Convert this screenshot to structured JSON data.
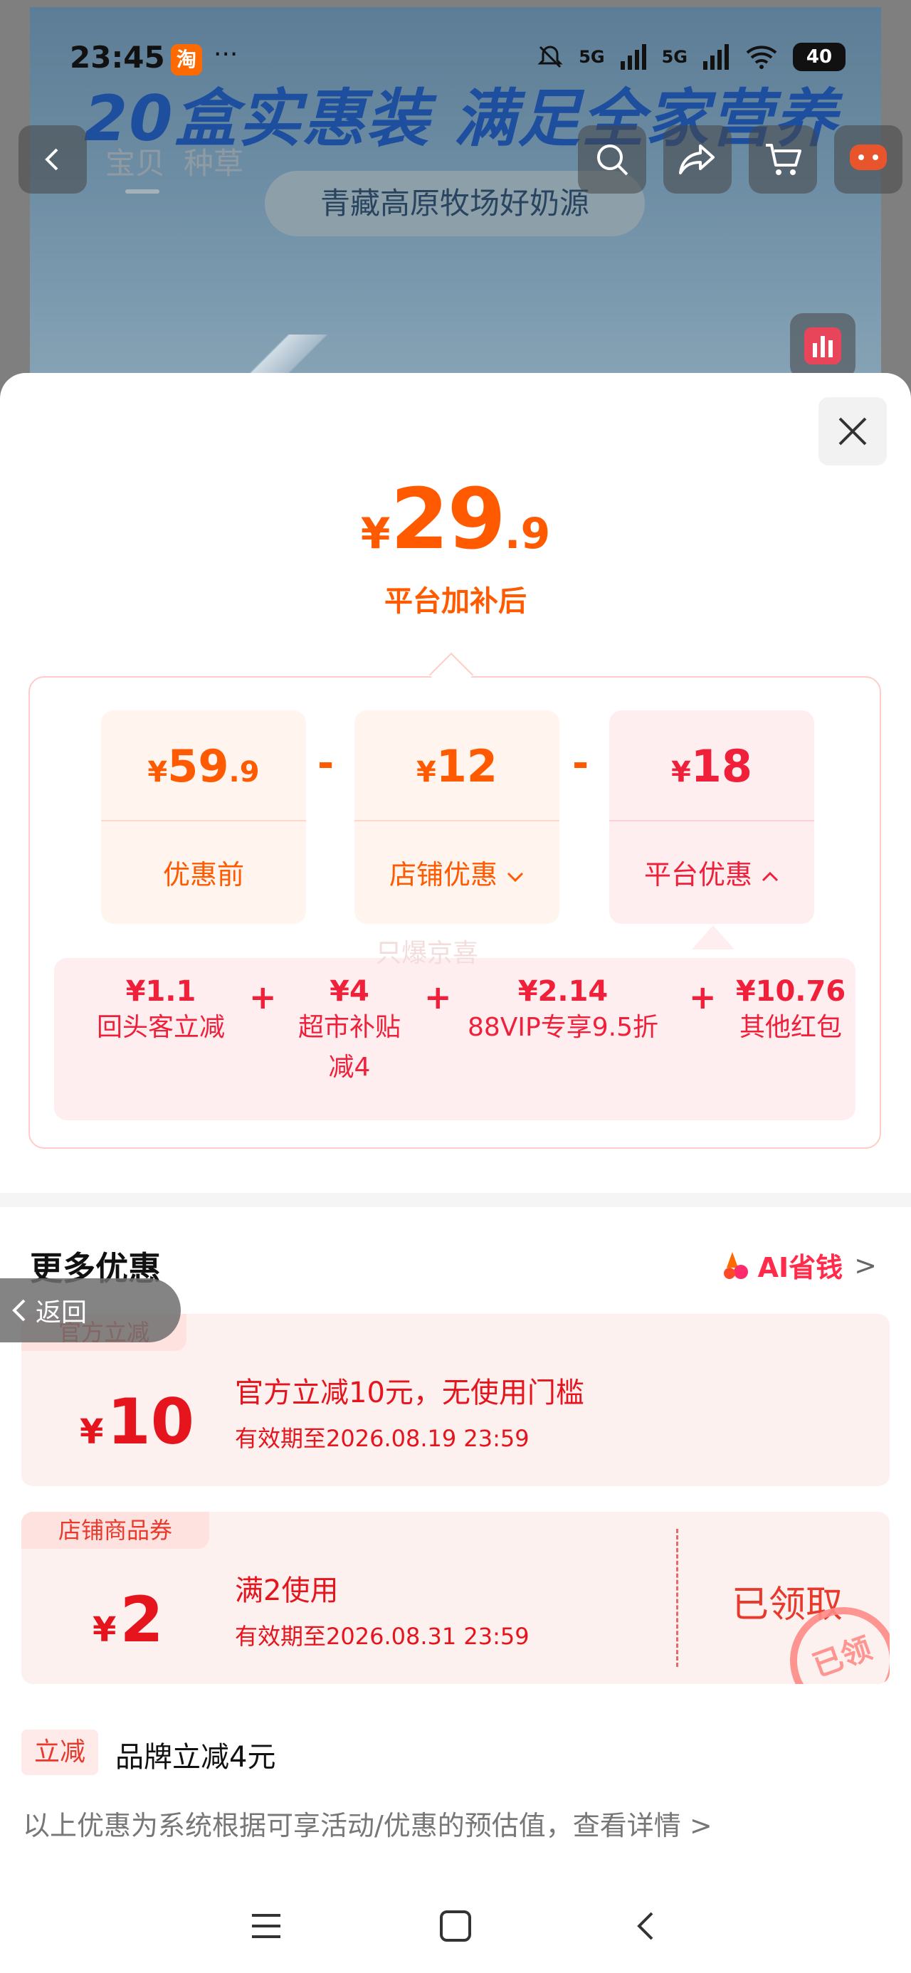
{
  "status_bar": {
    "time": "23:45",
    "app_badge": "淘",
    "dots": "···",
    "net1": "5G",
    "net2": "5G",
    "battery": "40"
  },
  "product_page": {
    "hero_title": "20盒实惠装 满足全家营养",
    "hero_subtitle": "青藏高原牧场好奶源",
    "tabs": [
      "宝贝",
      "种草"
    ]
  },
  "price": {
    "currency": "¥",
    "integer": "29",
    "decimal": ".9",
    "label": "平台加补后"
  },
  "breakdown": {
    "cards": [
      {
        "currency": "¥",
        "integer": "59",
        "decimal": ".9",
        "label": "优惠前"
      },
      {
        "currency": "¥",
        "integer": "12",
        "decimal": "",
        "label": "店铺优惠"
      },
      {
        "currency": "¥",
        "integer": "18",
        "decimal": "",
        "label": "平台优惠"
      }
    ],
    "operators": [
      "-",
      "-"
    ],
    "subsidies": [
      {
        "amount": "¥1.1",
        "desc": "回头客立减",
        "desc2": ""
      },
      {
        "amount": "¥4",
        "desc": "超市补贴",
        "desc2": "减4"
      },
      {
        "amount": "¥2.14",
        "desc": "88VIP专享9.5折",
        "desc2": ""
      },
      {
        "amount": "¥10.76",
        "desc": "其他红包",
        "desc2": ""
      }
    ],
    "plus": "+",
    "watermark": "只爆京喜"
  },
  "more": {
    "title": "更多优惠",
    "ai_label": "AI省钱",
    "ai_chevron": ">"
  },
  "back_float": "返回",
  "coupons": [
    {
      "tag": "官方立减",
      "currency": "¥",
      "amount": "10",
      "title": "官方立减10元，无使用门槛",
      "expiry": "有效期至2026.08.19 23:59"
    },
    {
      "tag": "店铺商品券",
      "currency": "¥",
      "amount": "2",
      "title": "满2使用",
      "expiry": "有效期至2026.08.31 23:59",
      "status": "已领取",
      "stamp": "已领"
    }
  ],
  "instant": {
    "tag": "立减",
    "text": "品牌立减4元"
  },
  "footnote": "以上优惠为系统根据可享活动/优惠的预估值，查看详情 >",
  "colors": {
    "accent_orange": "#ff5a00",
    "accent_red": "#f0203a",
    "coupon_red": "#e6141d"
  }
}
